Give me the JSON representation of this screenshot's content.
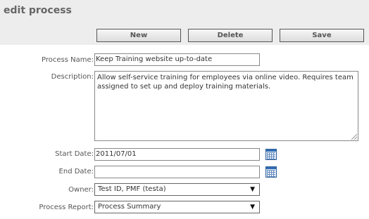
{
  "page": {
    "title": "edit process"
  },
  "toolbar": {
    "new_label": "New",
    "delete_label": "Delete",
    "save_label": "Save"
  },
  "form": {
    "process_name_label": "Process Name:",
    "process_name_value": "Keep Training website up-to-date",
    "description_label": "Description:",
    "description_value": "Allow self-service training for employees via online video. Requires team assigned to set up and deploy training materials.",
    "start_date_label": "Start Date:",
    "start_date_value": "2011/07/01",
    "end_date_label": "End Date:",
    "end_date_value": "",
    "owner_label": "Owner:",
    "owner_value": "Test ID, PMF (testa)",
    "process_report_label": "Process Report:",
    "process_report_value": "Process Summary"
  },
  "icons": {
    "calendar": "calendar-icon",
    "dropdown": "chevron-down-icon"
  },
  "colors": {
    "header_bg": "#ededed",
    "button_border": "#555555",
    "calendar_blue": "#2f6db3"
  }
}
